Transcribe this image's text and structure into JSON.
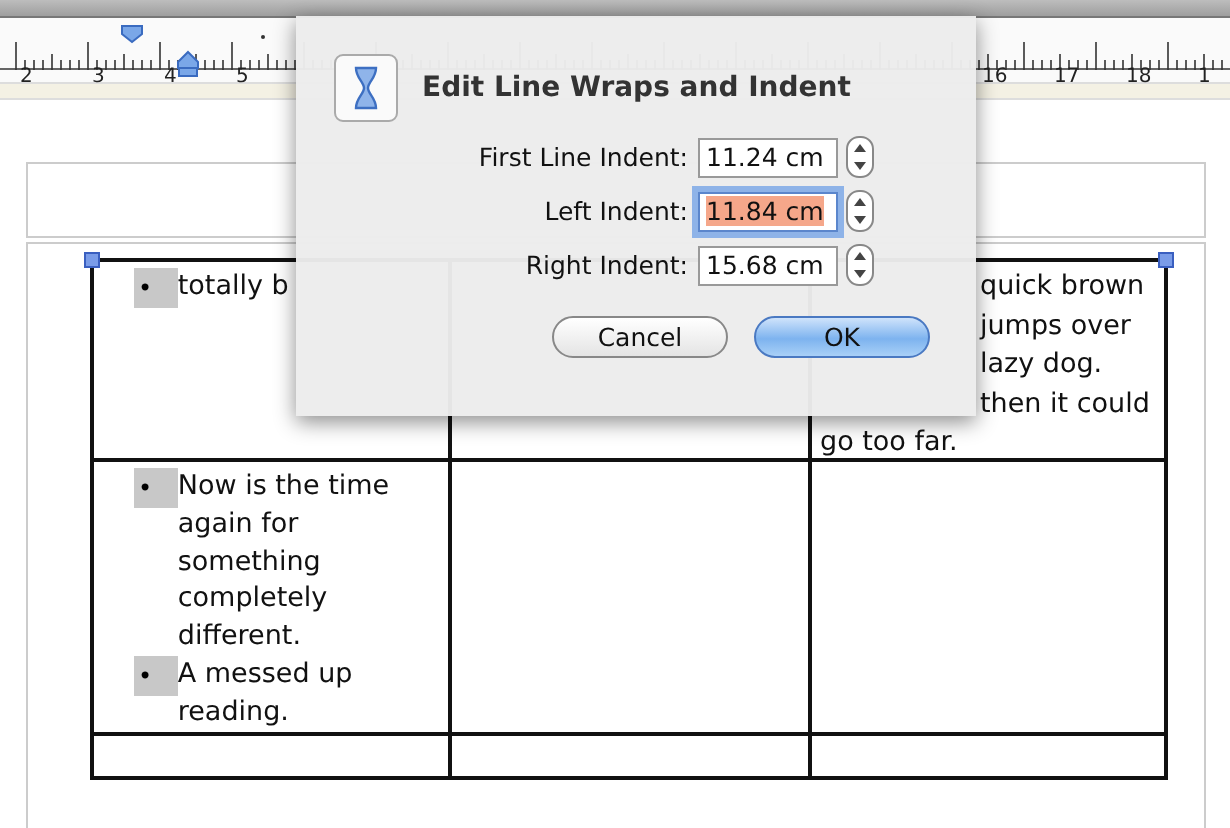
{
  "ruler": {
    "left_labels": [
      "2",
      "3",
      "4",
      "5"
    ],
    "right_labels": [
      "16",
      "17",
      "18",
      "1"
    ]
  },
  "dialog": {
    "title": "Edit Line Wraps and Indent",
    "fields": [
      {
        "label": "First Line Indent:",
        "value": "11.24 cm",
        "focused": false
      },
      {
        "label": "Left Indent:",
        "value": "11.84 cm",
        "focused": true
      },
      {
        "label": "Right Indent:",
        "value": "15.68 cm",
        "focused": false
      }
    ],
    "buttons": [
      {
        "label": "Cancel",
        "default": false
      },
      {
        "label": "OK",
        "default": true
      }
    ]
  },
  "table": {
    "rows": [
      {
        "cells": [
          {
            "kind": "bullets",
            "items": [
              {
                "bullet": "•",
                "text": "totally b"
              }
            ]
          },
          {
            "kind": "empty"
          },
          {
            "kind": "lines",
            "lines": [
              "quick brown",
              "jumps over",
              "lazy dog.",
              "then it could",
              "go too far."
            ]
          }
        ]
      },
      {
        "cells": [
          {
            "kind": "bullets",
            "items": [
              {
                "bullet": "•",
                "text": "Now is the time again for something completely different."
              },
              {
                "bullet": "•",
                "text": "A messed up reading."
              }
            ]
          },
          {
            "kind": "empty"
          },
          {
            "kind": "empty"
          }
        ]
      },
      {
        "cells": [
          {
            "kind": "empty"
          },
          {
            "kind": "empty"
          },
          {
            "kind": "empty"
          }
        ]
      }
    ]
  }
}
